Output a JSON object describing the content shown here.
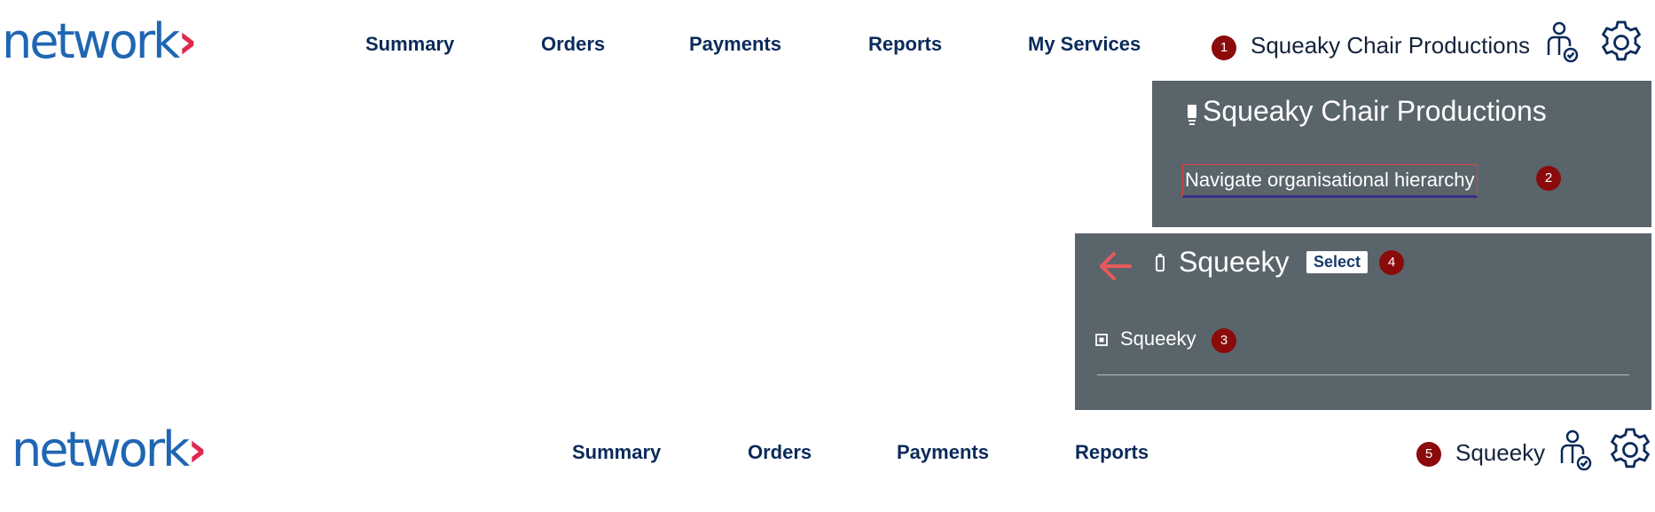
{
  "header_top": {
    "logo_text": "network",
    "logo_chevron": "›",
    "nav": [
      "Summary",
      "Orders",
      "Payments",
      "Reports",
      "My Services"
    ],
    "marker": "1",
    "org_name": "Squeaky Chair Productions"
  },
  "org_panel": {
    "title": "Squeaky Chair Productions",
    "navigate_label": "Navigate organisational hierarchy",
    "marker": "2"
  },
  "hierarchy_panel": {
    "title": "Squeeky",
    "select_label": "Select",
    "select_marker": "4",
    "child_label": "Squeeky",
    "child_marker": "3"
  },
  "header_bottom": {
    "logo_text": "network",
    "logo_chevron": "›",
    "nav": [
      "Summary",
      "Orders",
      "Payments",
      "Reports"
    ],
    "marker": "5",
    "org_name": "Squeeky"
  },
  "colors": {
    "brand_blue": "#1f66b3",
    "brand_red": "#e0284f",
    "navy": "#0b2a5b",
    "panel_grey": "#5a646b",
    "marker_red": "#8b0a0a"
  },
  "icons": [
    "user-check-icon",
    "gear-icon",
    "building-icon",
    "back-arrow-icon",
    "expand-square-icon"
  ]
}
